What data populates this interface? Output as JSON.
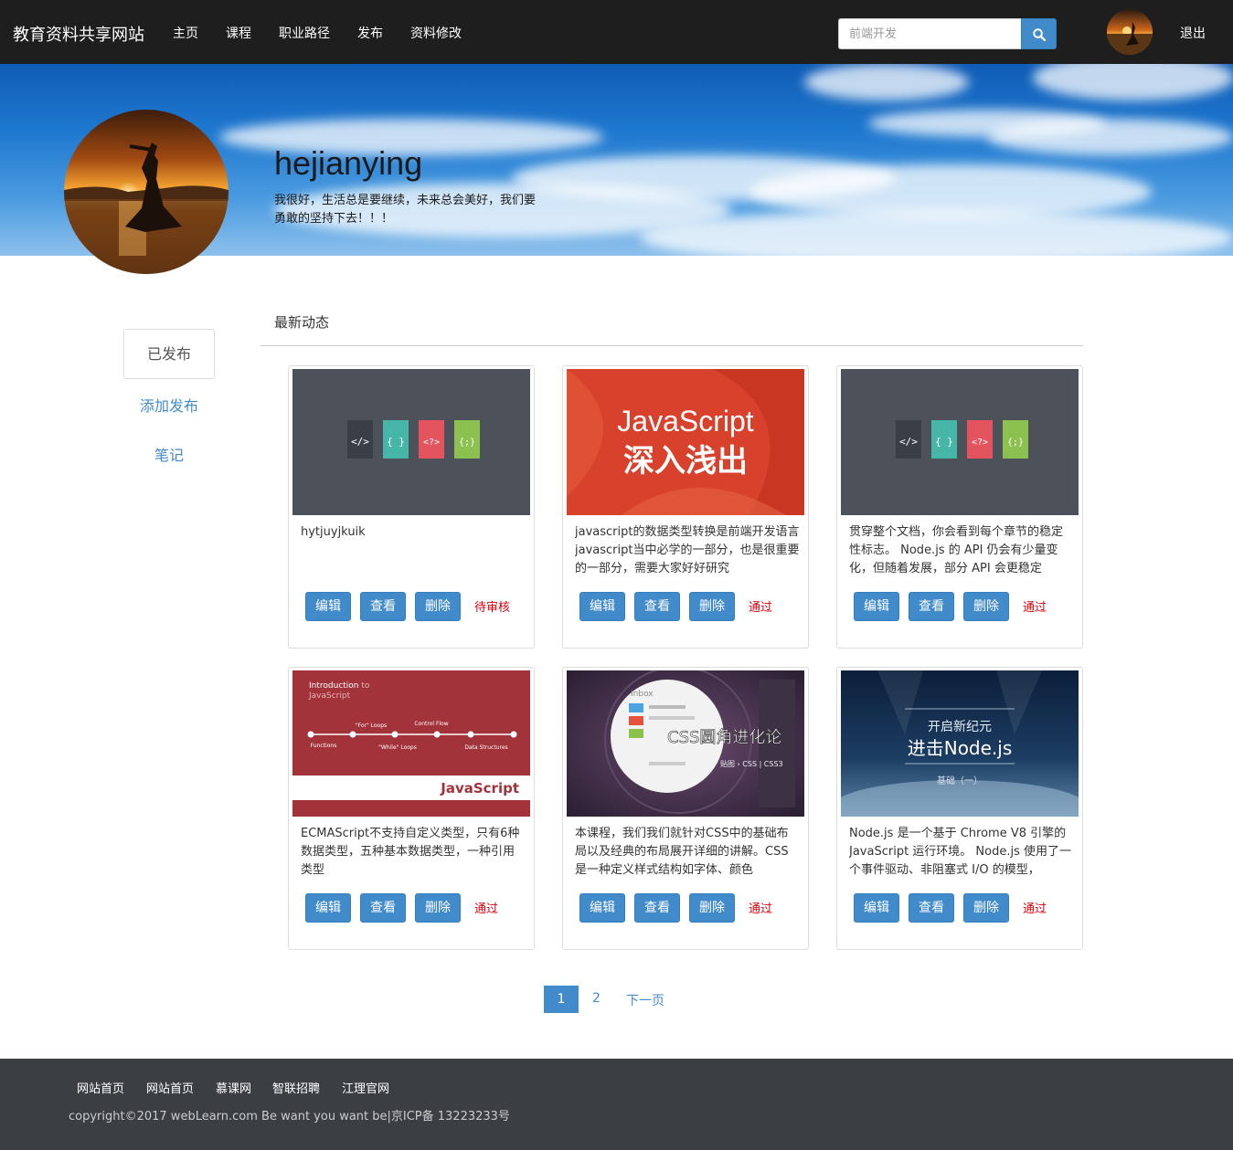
{
  "navbar": {
    "brand": "教育资料共享网站",
    "items": [
      "主页",
      "课程",
      "职业路径",
      "发布",
      "资料修改"
    ],
    "search_placeholder": "前端开发",
    "logout": "退出"
  },
  "profile": {
    "name": "hejianying",
    "bio": "我很好，生活总是要继续，未来总会美好，我们要勇敢的坚持下去！！！"
  },
  "sidebar": {
    "active": "已发布",
    "links": [
      "添加发布",
      "笔记"
    ]
  },
  "main": {
    "title": "最新动态",
    "button_labels": {
      "edit": "编辑",
      "view": "查看",
      "delete": "删除"
    },
    "cards": [
      {
        "text": "hytjuyjkuik",
        "status": "待审核",
        "thumb": "code-files"
      },
      {
        "text": "javascript的数据类型转换是前端开发语言javascript当中必学的一部分，也是很重要的一部分，需要大家好好研究",
        "status": "通过",
        "thumb": "javascript-course",
        "thumb_line1": "JavaScript",
        "thumb_line2": "深入浅出"
      },
      {
        "text": "贯穿整个文档，你会看到每个章节的稳定性标志。 Node.js 的 API 仍会有少量变化，但随着发展，部分 API 会更稳定",
        "status": "通过",
        "thumb": "code-files"
      },
      {
        "text": "ECMAScript不支持自定义类型，只有6种数据类型，五种基本数据类型，一种引用类型",
        "status": "通过",
        "thumb": "intro-javascript",
        "thumb_title1": "Introduction",
        "thumb_title_to": "to",
        "thumb_title2": "JavaScript",
        "thumb_labels": [
          "\"For\" Loops",
          "Control Flow",
          "Functions",
          "\"While\" Loops",
          "Data Structures"
        ],
        "thumb_brand": "JavaScript"
      },
      {
        "text": "本课程，我们我们就针对CSS中的基础布局以及经典的布局展开详细的讲解。CSS是一种定义样式结构如字体、颜色",
        "status": "通过",
        "thumb": "css-radius",
        "thumb_inbox": "Inbox",
        "thumb_title": "CSS圆角进化论",
        "thumb_tags": "贴图 › CSS | CSS3"
      },
      {
        "text": "Node.js 是一个基于 Chrome V8 引擎的 JavaScript 运行环境。 Node.js 使用了一个事件驱动、非阻塞式 I/O 的模型，",
        "status": "通过",
        "thumb": "nodejs-course",
        "thumb_line1": "开启新纪元",
        "thumb_line2": "进击Node.js",
        "thumb_line3": "基础（一）"
      }
    ]
  },
  "pagination": {
    "pages": [
      "1",
      "2"
    ],
    "next": "下一页",
    "current": "1"
  },
  "footer": {
    "links": [
      "网站首页",
      "网站首页",
      "慕课网",
      "智联招聘",
      "江理官网"
    ],
    "copyright": "copyright©2017 webLearn.com Be want you want be|京ICP备 13223233号"
  },
  "colors": {
    "primary": "#428bca",
    "status": "#d9000d",
    "navbar": "#1e1e1e",
    "footer": "#3b3e43"
  }
}
